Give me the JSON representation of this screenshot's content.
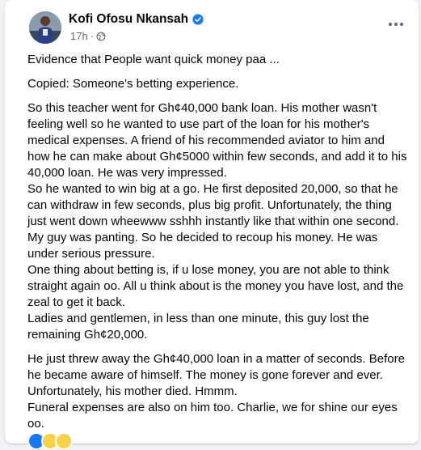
{
  "post": {
    "author": "Kofi Ofosu Nkansah",
    "time": "17h",
    "separator": "·",
    "paragraphs": [
      "Evidence that People want quick money paa ...",
      "Copied: Someone's betting experience.",
      "So this teacher went for Gh¢40,000 bank loan. His mother wasn't feeling well so he wanted to use part of the loan for his mother's medical expenses. A friend of his recommended aviator to him and how he can make about Gh¢5000 within few seconds, and add it to his 40,000 loan. He was very impressed.\nSo he wanted to win big at a go. He first deposited 20,000, so that he can withdraw in few seconds, plus big profit. Unfortunately, the thing just went down wheewww sshhh instantly like that within one second. My guy was panting. So he decided to recoup his money. He was under serious pressure.\nOne thing about betting is, if u lose money, you are not able to think straight again oo. All u think about is the money you have lost, and the zeal to get it back.\nLadies and gentlemen, in less than one minute, this guy lost the remaining Gh¢20,000.",
      "He just threw away the Gh¢40,000 loan in a matter of seconds. Before he became aware of himself. The money is gone forever and ever. Unfortunately, his mother died. Hmmm.\nFuneral expenses are also on him too. Charlie, we for shine our eyes oo."
    ]
  },
  "icons": {
    "verified": "verified-badge-icon",
    "audience": "globe-icon",
    "more": "more-options-icon"
  },
  "colors": {
    "background": "#f0f2f5",
    "card": "#ffffff",
    "text": "#050505",
    "secondary_text": "#65676b",
    "verified_blue": "#1877f2"
  }
}
